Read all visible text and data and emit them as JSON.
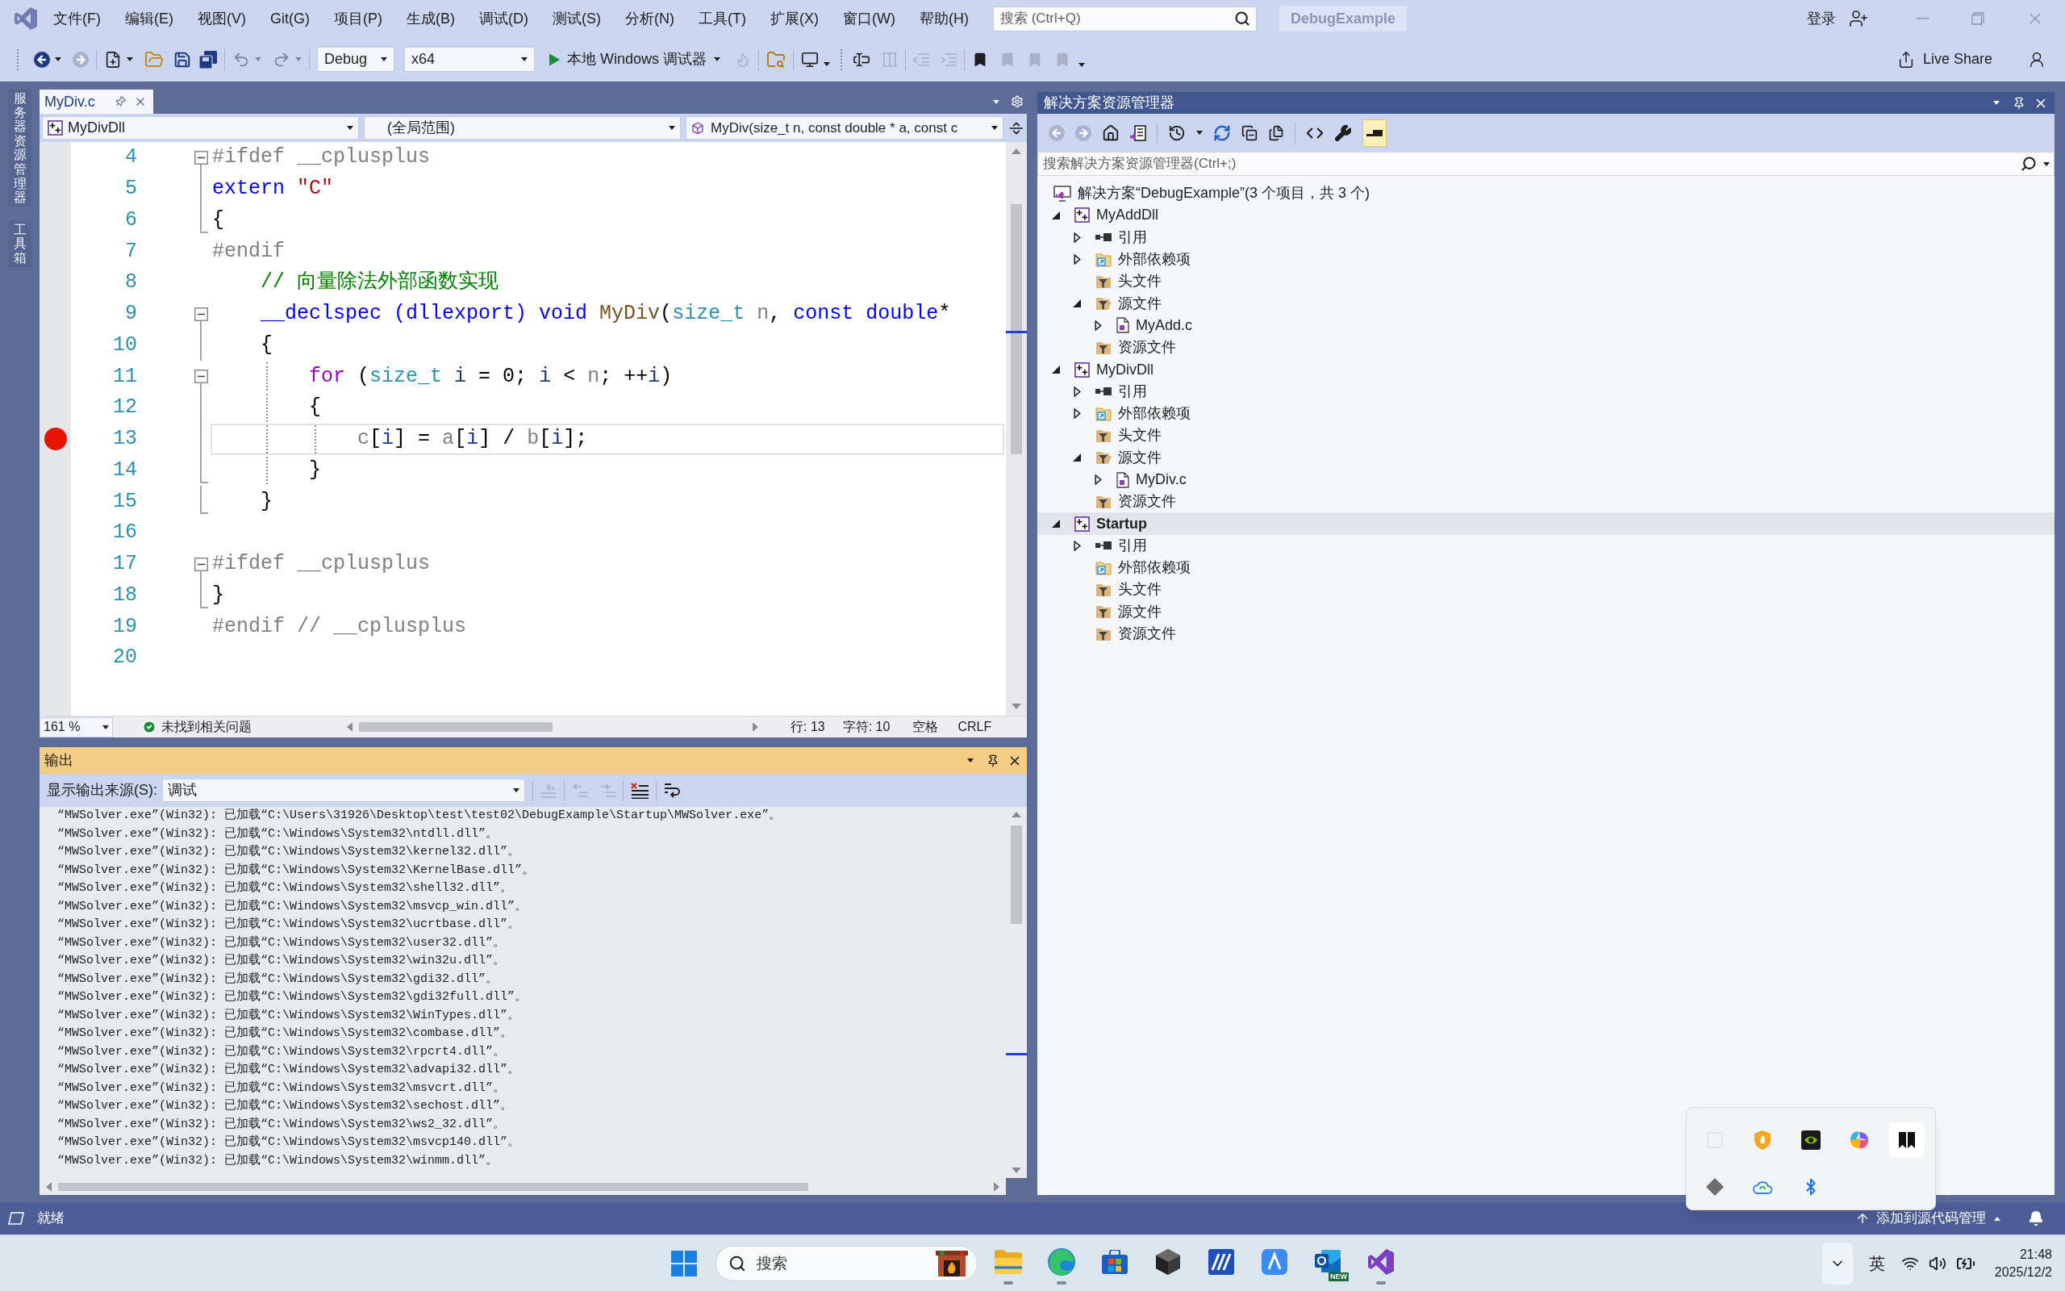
{
  "title_bar": {
    "menus": [
      "文件(F)",
      "编辑(E)",
      "视图(V)",
      "Git(G)",
      "项目(P)",
      "生成(B)",
      "调试(D)",
      "测试(S)",
      "分析(N)",
      "工具(T)",
      "扩展(X)",
      "窗口(W)",
      "帮助(H)"
    ],
    "search": {
      "placeholder": "搜索 (Ctrl+Q)"
    },
    "solution": "DebugExample",
    "sign_in": "登录"
  },
  "toolbar": {
    "configuration": "Debug",
    "platform": "x64",
    "run": "本地 Windows 调试器",
    "live_share": "Live Share"
  },
  "side_tabs": [
    "服务器资源管理器",
    "工具箱"
  ],
  "editor": {
    "tabs": [
      {
        "label": "MyDiv.c",
        "selected": true
      }
    ],
    "nav": {
      "project": "MyDivDll",
      "scope": "(全局范围)",
      "member": "MyDiv(size_t n, const double * a, const c"
    },
    "lines": [
      {
        "number": "4",
        "fold": {
          "kind": "start"
        },
        "breakpoint": false,
        "current": false,
        "tokens": [
          {
            "text": "#ifdef __cplusplus",
            "kind": "preprocessor"
          }
        ]
      },
      {
        "number": "5",
        "fold": {
          "kind": "inside"
        },
        "breakpoint": false,
        "current": false,
        "tokens": [
          {
            "text": "extern ",
            "kind": "keyword"
          },
          {
            "text": "\"C\"",
            "kind": "string"
          }
        ]
      },
      {
        "number": "6",
        "fold": {
          "kind": "end"
        },
        "breakpoint": false,
        "current": false,
        "tokens": [
          {
            "text": "{",
            "kind": "plain"
          }
        ]
      },
      {
        "number": "7",
        "breakpoint": false,
        "current": false,
        "tokens": [
          {
            "text": "#endif",
            "kind": "preprocessor"
          }
        ]
      },
      {
        "number": "8",
        "breakpoint": false,
        "current": false,
        "tokens": [
          {
            "text": "    // 向量除法外部函数实现",
            "kind": "comment"
          }
        ]
      },
      {
        "number": "9",
        "fold": {
          "kind": "start"
        },
        "breakpoint": false,
        "current": false,
        "tokens": [
          {
            "text": "    __declspec (dllexport) void ",
            "kind": "keyword"
          },
          {
            "text": "MyDiv",
            "kind": "function"
          },
          {
            "text": "(",
            "kind": "plain"
          },
          {
            "text": "size_t ",
            "kind": "type"
          },
          {
            "text": "n",
            "kind": "param"
          },
          {
            "text": ", ",
            "kind": "plain"
          },
          {
            "text": "const double",
            "kind": "keyword"
          },
          {
            "text": "*",
            "kind": "plain"
          }
        ]
      },
      {
        "number": "10",
        "fold": {
          "kind": "inside"
        },
        "breakpoint": false,
        "current": false,
        "tokens": [
          {
            "text": "    {",
            "kind": "plain"
          }
        ]
      },
      {
        "number": "11",
        "fold": {
          "kind": "start"
        },
        "breakpoint": false,
        "current": false,
        "tokens": [
          {
            "text": "        for",
            "kind": "control"
          },
          {
            "text": " (",
            "kind": "plain"
          },
          {
            "text": "size_t ",
            "kind": "type"
          },
          {
            "text": "i",
            "kind": "local"
          },
          {
            "text": " = 0; ",
            "kind": "plain"
          },
          {
            "text": "i",
            "kind": "local"
          },
          {
            "text": " < ",
            "kind": "plain"
          },
          {
            "text": "n",
            "kind": "param"
          },
          {
            "text": "; ++",
            "kind": "plain"
          },
          {
            "text": "i",
            "kind": "local"
          },
          {
            "text": ")",
            "kind": "plain"
          }
        ]
      },
      {
        "number": "12",
        "fold": {
          "kind": "inside"
        },
        "breakpoint": false,
        "current": false,
        "tokens": [
          {
            "text": "        {",
            "kind": "plain"
          }
        ]
      },
      {
        "number": "13",
        "fold": {
          "kind": "inside"
        },
        "breakpoint": true,
        "current": true,
        "tokens": [
          {
            "text": "            c",
            "kind": "param"
          },
          {
            "text": "[",
            "kind": "plain"
          },
          {
            "text": "i",
            "kind": "local"
          },
          {
            "text": "] = ",
            "kind": "plain"
          },
          {
            "text": "a",
            "kind": "param"
          },
          {
            "text": "[",
            "kind": "plain"
          },
          {
            "text": "i",
            "kind": "local"
          },
          {
            "text": "] / ",
            "kind": "plain"
          },
          {
            "text": "b",
            "kind": "param"
          },
          {
            "text": "[",
            "kind": "plain"
          },
          {
            "text": "i",
            "kind": "local"
          },
          {
            "text": "];",
            "kind": "plain"
          }
        ]
      },
      {
        "number": "14",
        "fold": {
          "kind": "end"
        },
        "breakpoint": false,
        "current": false,
        "tokens": [
          {
            "text": "        }",
            "kind": "plain"
          }
        ]
      },
      {
        "number": "15",
        "fold": {
          "kind": "end"
        },
        "breakpoint": false,
        "current": false,
        "tokens": [
          {
            "text": "    }",
            "kind": "plain"
          }
        ]
      },
      {
        "number": "16",
        "breakpoint": false,
        "current": false
      },
      {
        "number": "17",
        "fold": {
          "kind": "start"
        },
        "breakpoint": false,
        "current": false,
        "tokens": [
          {
            "text": "#ifdef __cplusplus",
            "kind": "preprocessor"
          }
        ]
      },
      {
        "number": "18",
        "fold": {
          "kind": "end"
        },
        "breakpoint": false,
        "current": false,
        "tokens": [
          {
            "text": "}",
            "kind": "plain"
          }
        ]
      },
      {
        "number": "19",
        "breakpoint": false,
        "current": false,
        "tokens": [
          {
            "text": "#endif // __cplusplus",
            "kind": "preprocessor"
          }
        ]
      },
      {
        "number": "20",
        "breakpoint": false,
        "current": false
      }
    ],
    "status": {
      "zoom": "161 %",
      "issues": "未找到相关问题",
      "line": "行: 13",
      "column": "字符: 10",
      "whitespace": "空格",
      "line_ending": "CRLF"
    }
  },
  "output": {
    "title": "输出",
    "source_label": "显示输出来源(S):",
    "source": "调试",
    "lines": [
      "“MWSolver.exe”(Win32): 已加载“C:\\Users\\31926\\Desktop\\test\\test02\\DebugExample\\Startup\\MWSolver.exe”。",
      "“MWSolver.exe”(Win32): 已加载“C:\\Windows\\System32\\ntdll.dll”。",
      "“MWSolver.exe”(Win32): 已加载“C:\\Windows\\System32\\kernel32.dll”。",
      "“MWSolver.exe”(Win32): 已加载“C:\\Windows\\System32\\KernelBase.dll”。",
      "“MWSolver.exe”(Win32): 已加载“C:\\Windows\\System32\\shell32.dll”。",
      "“MWSolver.exe”(Win32): 已加载“C:\\Windows\\System32\\msvcp_win.dll”。",
      "“MWSolver.exe”(Win32): 已加载“C:\\Windows\\System32\\ucrtbase.dll”。",
      "“MWSolver.exe”(Win32): 已加载“C:\\Windows\\System32\\user32.dll”。",
      "“MWSolver.exe”(Win32): 已加载“C:\\Windows\\System32\\win32u.dll”。",
      "“MWSolver.exe”(Win32): 已加载“C:\\Windows\\System32\\gdi32.dll”。",
      "“MWSolver.exe”(Win32): 已加载“C:\\Windows\\System32\\gdi32full.dll”。",
      "“MWSolver.exe”(Win32): 已加载“C:\\Windows\\System32\\WinTypes.dll”。",
      "“MWSolver.exe”(Win32): 已加载“C:\\Windows\\System32\\combase.dll”。",
      "“MWSolver.exe”(Win32): 已加载“C:\\Windows\\System32\\rpcrt4.dll”。",
      "“MWSolver.exe”(Win32): 已加载“C:\\Windows\\System32\\advapi32.dll”。",
      "“MWSolver.exe”(Win32): 已加载“C:\\Windows\\System32\\msvcrt.dll”。",
      "“MWSolver.exe”(Win32): 已加载“C:\\Windows\\System32\\sechost.dll”。",
      "“MWSolver.exe”(Win32): 已加载“C:\\Windows\\System32\\ws2_32.dll”。",
      "“MWSolver.exe”(Win32): 已加载“C:\\Windows\\System32\\msvcp140.dll”。",
      "“MWSolver.exe”(Win32): 已加载“C:\\Windows\\System32\\winmm.dll”。"
    ]
  },
  "solution_explorer": {
    "title": "解决方案资源管理器",
    "preview_toggle": {
      "on": true
    },
    "search": {
      "placeholder": "搜索解决方案资源管理器(Ctrl+;)"
    },
    "tree": [
      {
        "kind": "solution",
        "label": "解决方案“DebugExample”(3 个项目，共 3 个)",
        "selected": false,
        "children": [
          {
            "kind": "project",
            "label": "MyAddDll",
            "expanded": true,
            "startup": false,
            "selected": false,
            "children": [
              {
                "kind": "references",
                "label": "引用",
                "expanded": false,
                "selected": false
              },
              {
                "kind": "external",
                "label": "外部依赖项",
                "expanded": false,
                "selected": false
              },
              {
                "kind": "filter",
                "label": "头文件",
                "selected": false
              },
              {
                "kind": "filter",
                "label": "源文件",
                "expanded": true,
                "selected": false,
                "children": [
                  {
                    "kind": "source-file",
                    "label": "MyAdd.c",
                    "expanded": false,
                    "selected": false
                  }
                ]
              },
              {
                "kind": "filter",
                "label": "资源文件",
                "selected": false
              }
            ]
          },
          {
            "kind": "project",
            "label": "MyDivDll",
            "expanded": true,
            "startup": false,
            "selected": false,
            "children": [
              {
                "kind": "references",
                "label": "引用",
                "expanded": false,
                "selected": false
              },
              {
                "kind": "external",
                "label": "外部依赖项",
                "expanded": false,
                "selected": false
              },
              {
                "kind": "filter",
                "label": "头文件",
                "selected": false
              },
              {
                "kind": "filter",
                "label": "源文件",
                "expanded": true,
                "selected": false,
                "children": [
                  {
                    "kind": "source-file",
                    "label": "MyDiv.c",
                    "expanded": false,
                    "selected": false
                  }
                ]
              },
              {
                "kind": "filter",
                "label": "资源文件",
                "selected": false
              }
            ]
          },
          {
            "kind": "project",
            "label": "Startup",
            "expanded": true,
            "startup": true,
            "selected": true,
            "children": [
              {
                "kind": "references",
                "label": "引用",
                "expanded": false,
                "selected": false
              },
              {
                "kind": "external",
                "label": "外部依赖项",
                "selected": false
              },
              {
                "kind": "filter",
                "label": "头文件",
                "selected": false
              },
              {
                "kind": "filter",
                "label": "源文件",
                "selected": false
              },
              {
                "kind": "filter",
                "label": "资源文件",
                "selected": false
              }
            ]
          }
        ]
      }
    ]
  },
  "status_bar": {
    "message": "就绪",
    "source_control": "添加到源代码管理"
  },
  "taskbar": {
    "search": {
      "placeholder": "搜索"
    },
    "apps": [
      {
        "kind": "explorer",
        "running": true
      },
      {
        "kind": "edge",
        "running": true
      },
      {
        "kind": "store",
        "running": false
      },
      {
        "kind": "hexagon",
        "running": false
      },
      {
        "kind": "m-app",
        "running": false
      },
      {
        "kind": "a-app",
        "running": false
      },
      {
        "kind": "outlook",
        "running": false,
        "badge": "NEW"
      },
      {
        "kind": "visual-studio",
        "running": true
      }
    ],
    "ime": "英",
    "time": "21:48",
    "date": "2025/12/2"
  }
}
